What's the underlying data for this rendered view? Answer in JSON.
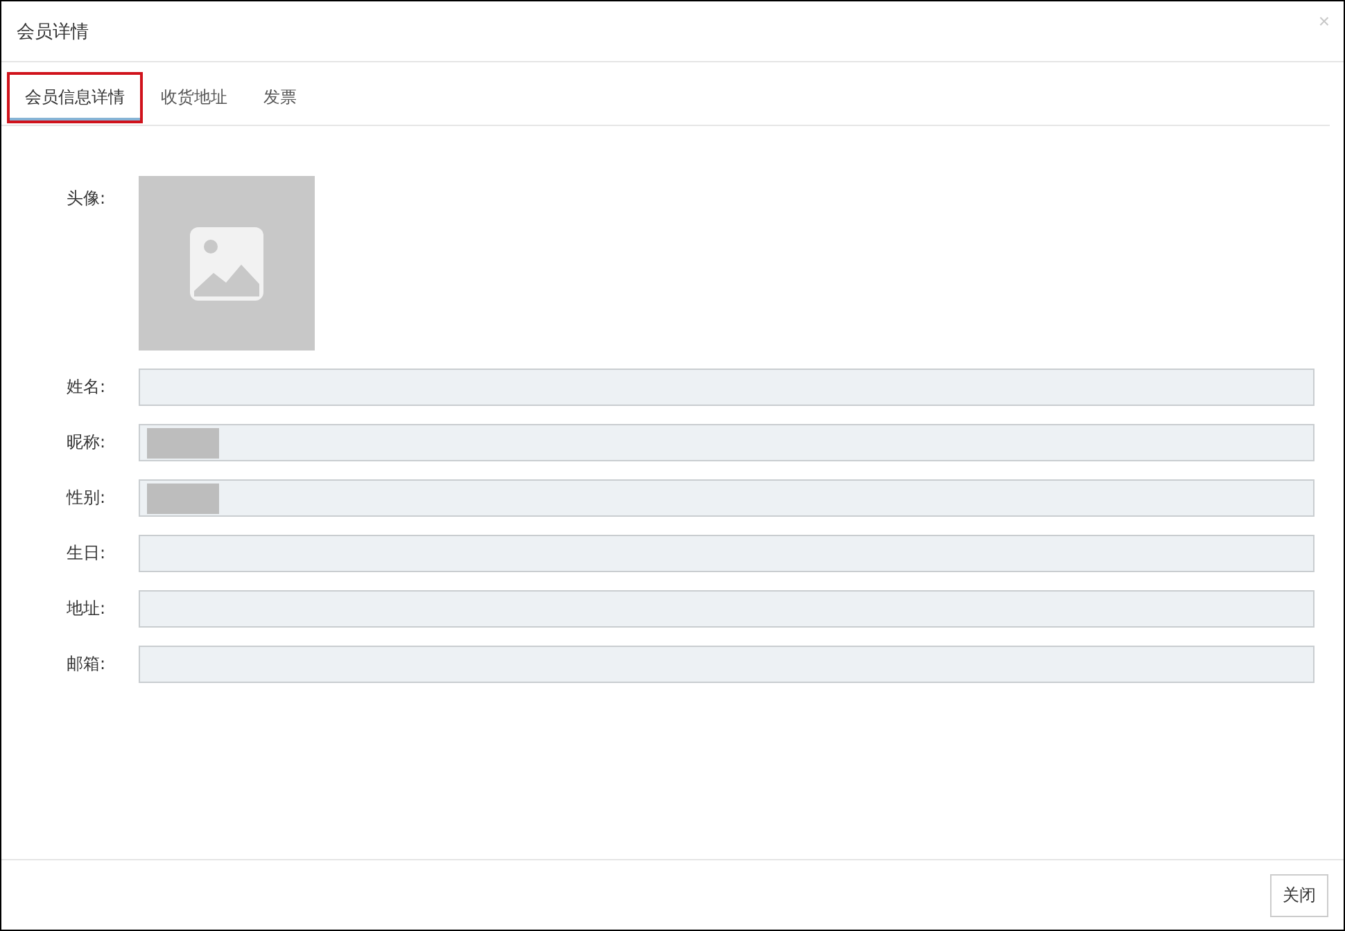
{
  "dialog": {
    "title": "会员详情",
    "close_icon": "×"
  },
  "tabs": [
    {
      "label": "会员信息详情",
      "selected": true
    },
    {
      "label": "收货地址",
      "selected": false
    },
    {
      "label": "发票",
      "selected": false
    }
  ],
  "avatar": {
    "label": "头像:"
  },
  "fields": [
    {
      "label": "姓名:"
    },
    {
      "label": "昵称:",
      "redacted": true
    },
    {
      "label": "性别:",
      "redacted": true
    },
    {
      "label": "生日:"
    },
    {
      "label": "地址:"
    },
    {
      "label": "邮箱:"
    }
  ],
  "buttons": [
    "关闭"
  ]
}
